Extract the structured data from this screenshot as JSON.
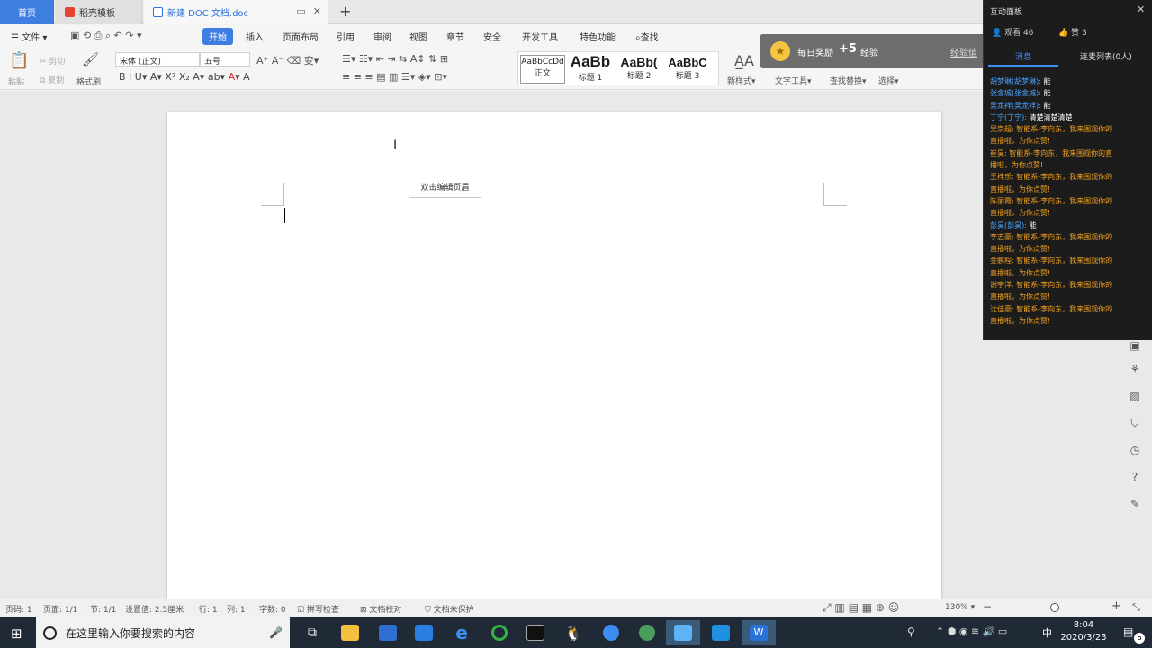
{
  "tabs": {
    "home": "首页",
    "templates": "稻壳模板",
    "doc": "新建 DOC 文档.doc",
    "new_tab": "+"
  },
  "menu": {
    "file": "文件",
    "items": [
      "开始",
      "插入",
      "页面布局",
      "引用",
      "审阅",
      "视图",
      "章节",
      "安全",
      "开发工具",
      "特色功能"
    ],
    "search": "查找"
  },
  "ribbon": {
    "paste": "粘贴",
    "cut": "剪切",
    "copy": "复制",
    "format_painter": "格式刷",
    "font": "宋体 (正文)",
    "size": "五号",
    "styles": [
      {
        "sample": "AaBbCcDd",
        "label": "正文"
      },
      {
        "sample": "AaBb",
        "label": "标题 1"
      },
      {
        "sample": "AaBb(",
        "label": "标题 2"
      },
      {
        "sample": "AaBbC",
        "label": "标题 3"
      }
    ],
    "new_style": "新样式",
    "text_tools": "文字工具",
    "find_replace": "查找替换",
    "select": "选择"
  },
  "document": {
    "header_tip": "双击编辑页眉"
  },
  "reward": {
    "title": "每日奖励",
    "points": "+5",
    "unit": "经验",
    "link": "经验值"
  },
  "panel": {
    "title": "互动面板",
    "viewers": "观看 46",
    "likes": "赞 3",
    "tab_messages": "消息",
    "tab_mic": "连麦列表(0人)",
    "chat": [
      {
        "name": "胡梦琳(胡梦琳):",
        "text": "能",
        "color": "#4aa3ff"
      },
      {
        "name": "张金城(张金城):",
        "text": "能",
        "color": "#4aa3ff"
      },
      {
        "name": "吴龙祥(吴龙祥):",
        "text": "能",
        "color": "#4aa3ff"
      },
      {
        "name": "丁宁(丁宁):",
        "text": "清楚清楚清楚",
        "color": "#4aa3ff"
      },
      {
        "name": "吴崇超:",
        "text": "智能系-李向东，我来围观你的直播啦，为你点赞!",
        "color": "#f0a020"
      },
      {
        "name": "崔昊:",
        "text": "智能系-李向东，我来围观你的直播啦，为你点赞!",
        "color": "#f0a020"
      },
      {
        "name": "王梓乐:",
        "text": "智能系-李向东，我来围观你的直播啦，为你点赞!",
        "color": "#f0a020"
      },
      {
        "name": "陈丽霞:",
        "text": "智能系-李向东，我来围观你的直播啦，为你点赞!",
        "color": "#f0a020"
      },
      {
        "name": "彭昊(彭昊):",
        "text": "能",
        "color": "#4aa3ff"
      },
      {
        "name": "李志豪:",
        "text": "智能系-李向东，我来围观你的直播啦，为你点赞!",
        "color": "#f0a020"
      },
      {
        "name": "金鹏程:",
        "text": "智能系-李向东，我来围观你的直播啦，为你点赞!",
        "color": "#f0a020"
      },
      {
        "name": "谢宇洋:",
        "text": "智能系-李向东，我来围观你的直播啦，为你点赞!",
        "color": "#f0a020"
      },
      {
        "name": "沈佳豪:",
        "text": "智能系-李向东，我来围观你的直播啦，为你点赞!",
        "color": "#f0a020"
      }
    ]
  },
  "status": {
    "page": "页码: 1",
    "pages": "页面: 1/1",
    "section": "节: 1/1",
    "setting": "设置值: 2.5厘米",
    "row": "行: 1",
    "col": "列: 1",
    "words": "字数: 0",
    "spell": "拼写检查",
    "proof": "文档校对",
    "protect": "文档未保护",
    "zoom": "130%"
  },
  "taskbar": {
    "search_placeholder": "在这里输入你要搜索的内容",
    "time": "8:04",
    "date": "2020/3/23",
    "ime": "中",
    "notif": "6"
  }
}
